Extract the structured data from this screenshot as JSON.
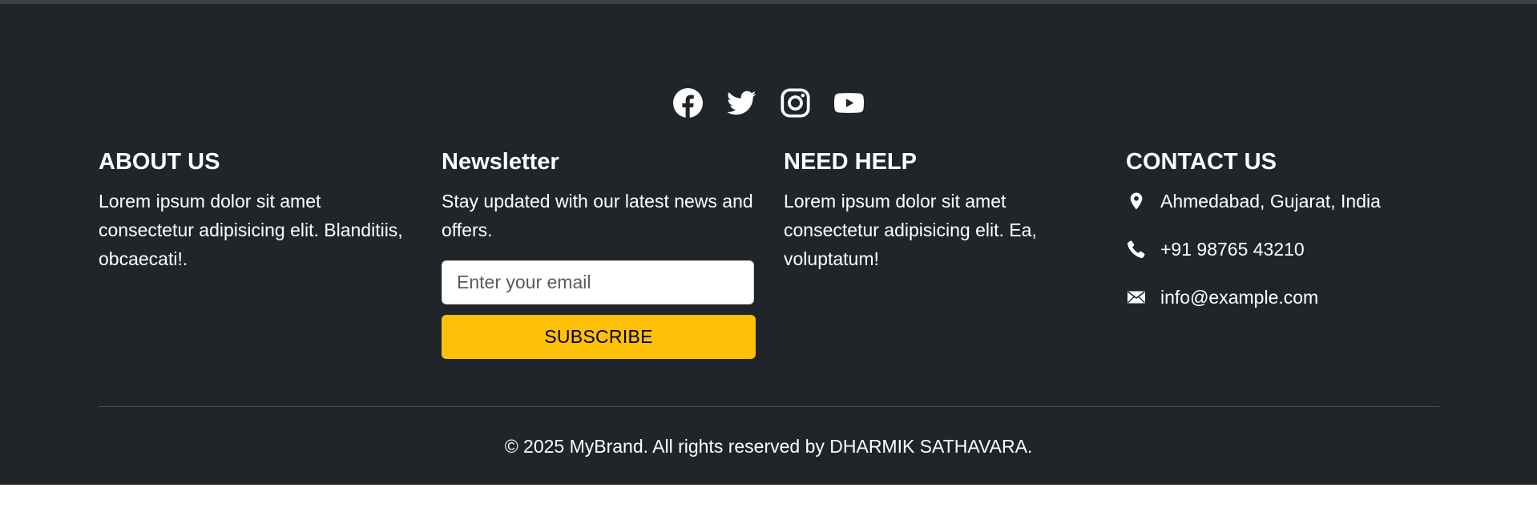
{
  "social": [
    {
      "name": "facebook-icon",
      "label": "Facebook"
    },
    {
      "name": "twitter-icon",
      "label": "Twitter"
    },
    {
      "name": "instagram-icon",
      "label": "Instagram"
    },
    {
      "name": "youtube-icon",
      "label": "YouTube"
    }
  ],
  "about": {
    "title": "ABOUT US",
    "text": "Lorem ipsum dolor sit amet consectetur adipisicing elit. Blanditiis, obcaecati!."
  },
  "newsletter": {
    "title": "Newsletter",
    "text": "Stay updated with our latest news and offers.",
    "email_placeholder": "Enter your email",
    "email_value": "",
    "subscribe_label": "SUBSCRIBE"
  },
  "help": {
    "title": "NEED HELP",
    "text": "Lorem ipsum dolor sit amet consectetur adipisicing elit. Ea, voluptatum!"
  },
  "contact": {
    "title": "CONTACT US",
    "items": [
      {
        "icon": "map-pin-icon",
        "text": "Ahmedabad, Gujarat, India"
      },
      {
        "icon": "phone-icon",
        "text": "+91 98765 43210"
      },
      {
        "icon": "envelope-icon",
        "text": "info@example.com"
      }
    ]
  },
  "copyright": "© 2025 MyBrand. All rights reserved by DHARMIK SATHAVARA.",
  "colors": {
    "footer_bg": "#212529",
    "accent": "#ffc107",
    "text": "#ffffff"
  }
}
